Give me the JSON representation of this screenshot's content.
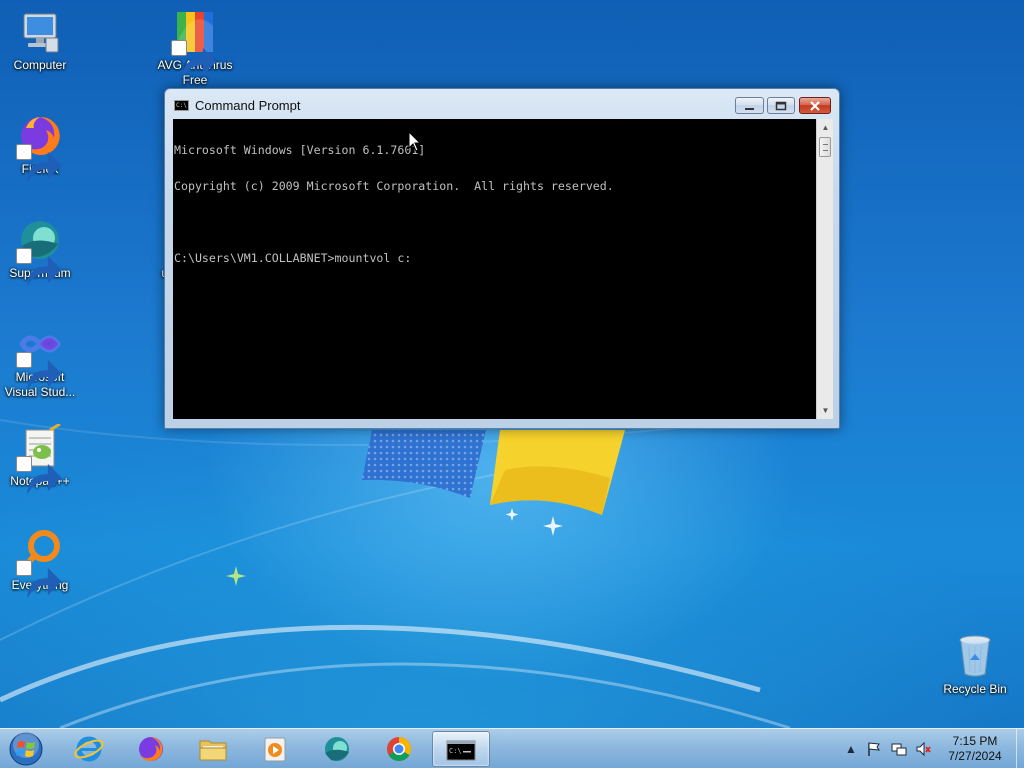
{
  "desktop": {
    "icons": [
      {
        "label": "Computer",
        "icon": "computer-icon"
      },
      {
        "label": "AVG AntiVirus Free",
        "icon": "avg-antivirus-icon"
      },
      {
        "label": "Firefox",
        "icon": "firefox-icon"
      },
      {
        "label": "Supermium",
        "icon": "supermium-icon"
      },
      {
        "label": "Microsoft Visual Stud...",
        "icon": "visual-studio-icon"
      },
      {
        "label": "Notepad++",
        "icon": "notepadpp-icon"
      },
      {
        "label": "Everything",
        "icon": "everything-icon"
      },
      {
        "label": "Recycle Bin",
        "icon": "recycle-bin-icon"
      }
    ],
    "partial_label": "u"
  },
  "window": {
    "title": "Command Prompt",
    "console_lines": [
      "Microsoft Windows [Version 6.1.7601]",
      "Copyright (c) 2009 Microsoft Corporation.  All rights reserved.",
      "",
      "C:\\Users\\VM1.COLLABNET>mountvol c:"
    ]
  },
  "taskbar": {
    "items": [
      {
        "name": "internet-explorer",
        "icon": "internet-explorer-icon"
      },
      {
        "name": "firefox",
        "icon": "firefox-icon"
      },
      {
        "name": "file-explorer",
        "icon": "folder-icon"
      },
      {
        "name": "media-player",
        "icon": "media-player-icon"
      },
      {
        "name": "supermium",
        "icon": "supermium-icon"
      },
      {
        "name": "chrome",
        "icon": "chrome-icon"
      },
      {
        "name": "command-prompt",
        "icon": "cmd-icon",
        "active": true
      }
    ],
    "clock": {
      "time": "7:15 PM",
      "date": "7/27/2024"
    }
  },
  "colors": {
    "console_bg": "#000000",
    "console_text": "#c0c0c0",
    "close_button": "#c23a1f"
  }
}
